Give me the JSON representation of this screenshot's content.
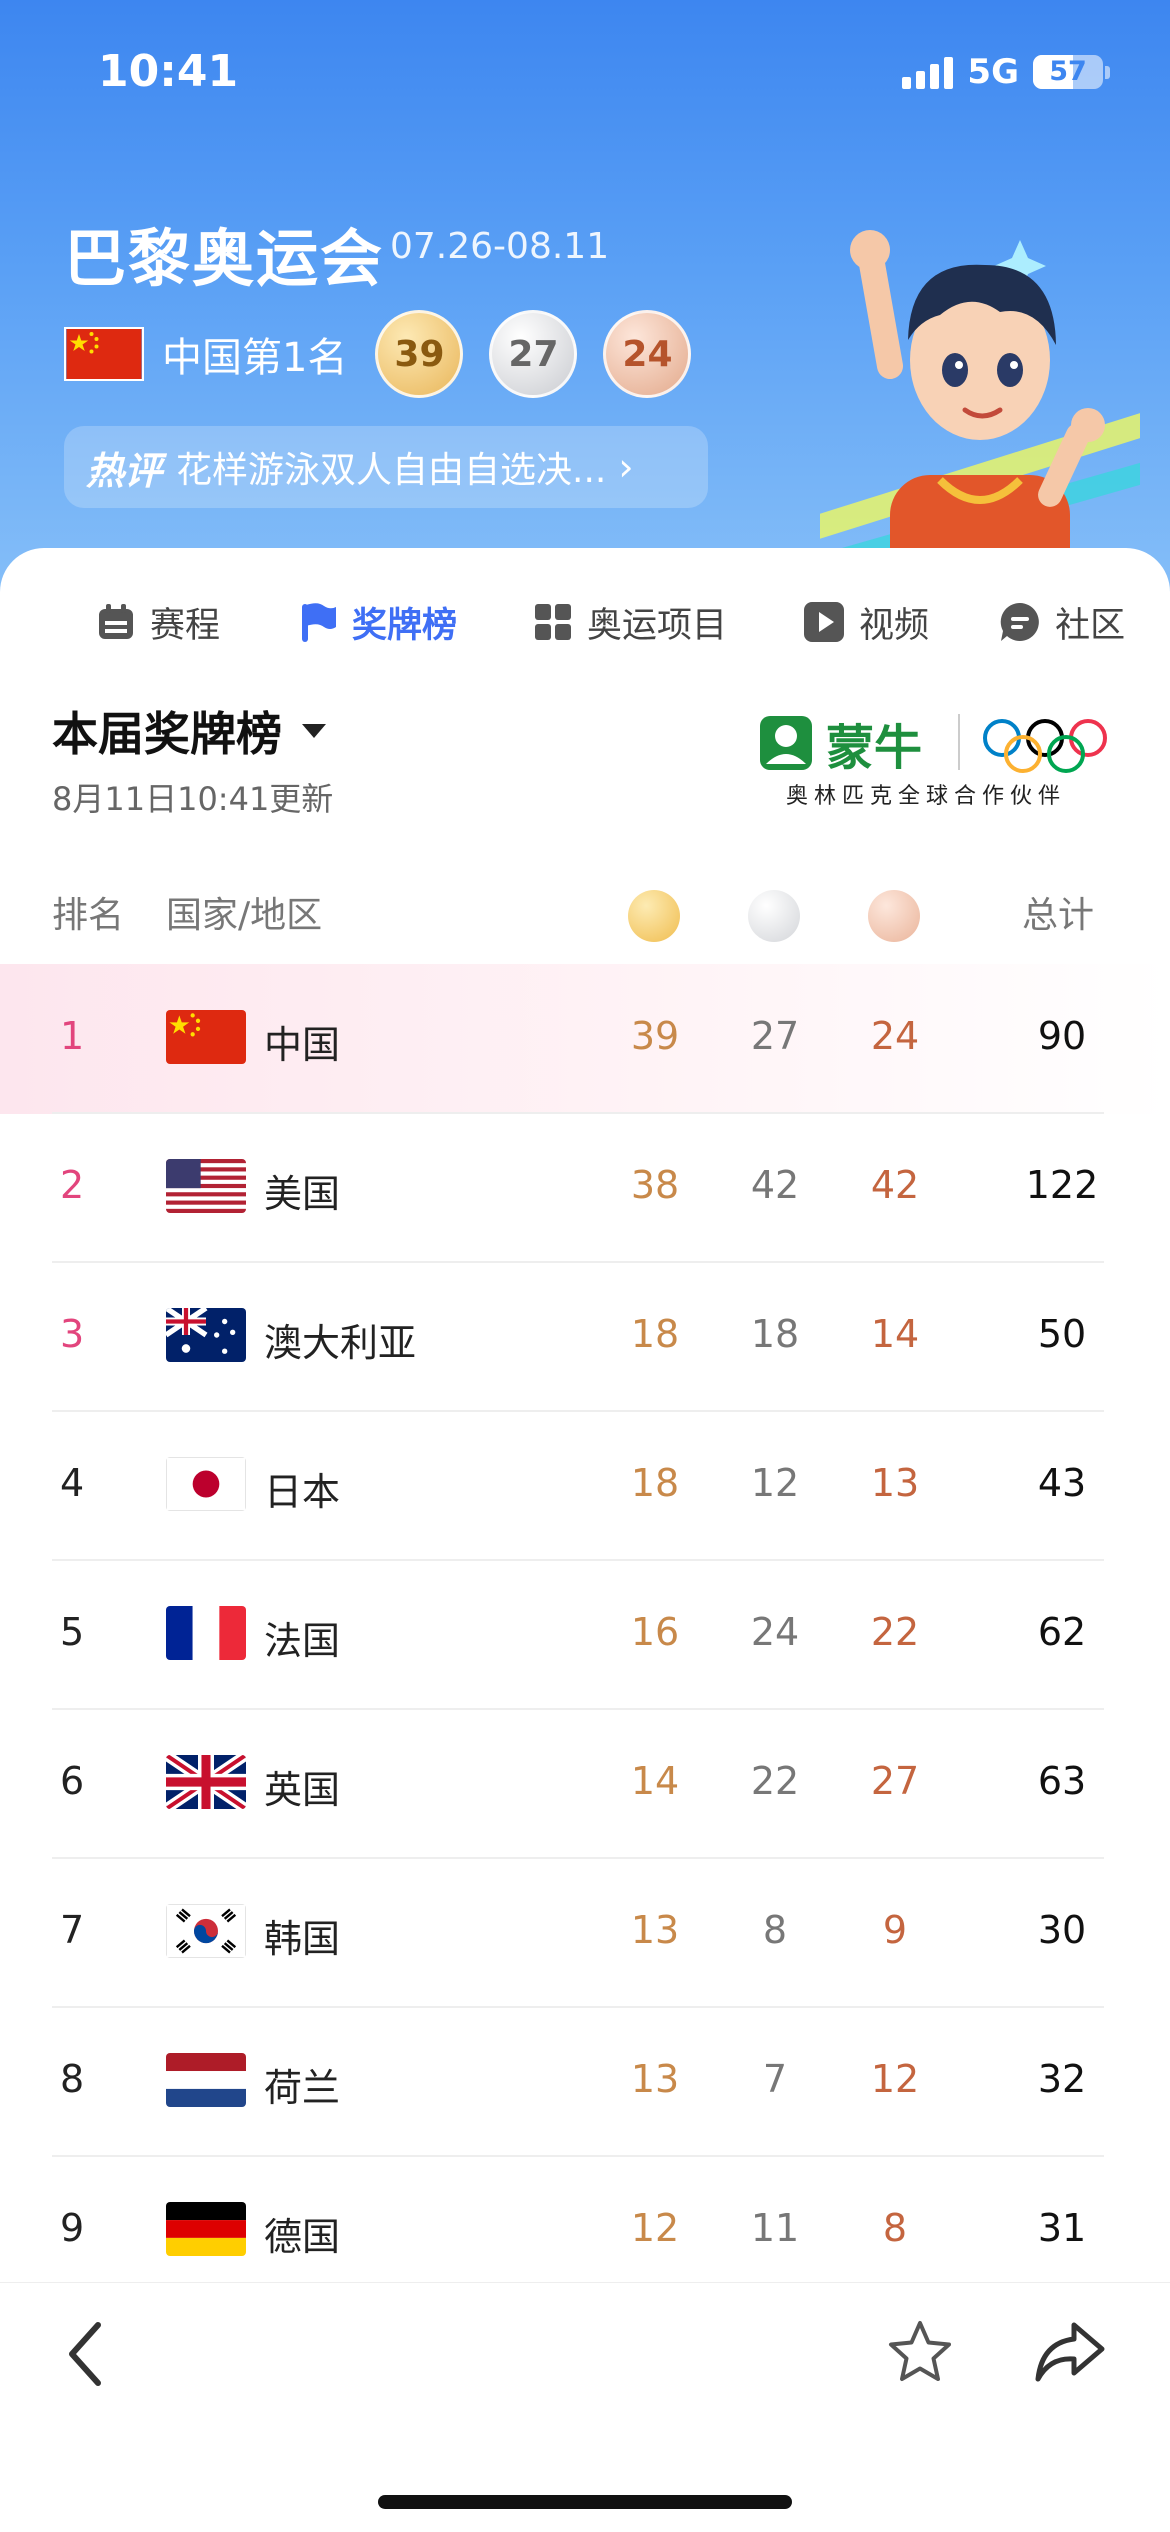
{
  "status_bar": {
    "time": "10:41",
    "network": "5G",
    "battery": "57"
  },
  "header": {
    "title": "巴黎奥运会",
    "dates": "07.26-08.11",
    "rank_text": "中国第1名",
    "medals": {
      "gold": "39",
      "silver": "27",
      "bronze": "24"
    },
    "hot": {
      "tag": "热评",
      "text": "花样游泳双人自由自选决..."
    }
  },
  "tabs": [
    {
      "label": "赛程",
      "icon": "calendar-icon",
      "active": false
    },
    {
      "label": "奖牌榜",
      "icon": "flag-icon",
      "active": true
    },
    {
      "label": "奥运项目",
      "icon": "grid-icon",
      "active": false
    },
    {
      "label": "视频",
      "icon": "play-icon",
      "active": false
    },
    {
      "label": "社区",
      "icon": "chat-icon",
      "active": false
    }
  ],
  "board": {
    "title": "本届奖牌榜",
    "updated": "8月11日10:41更新",
    "sponsor": {
      "name": "蒙牛",
      "subtitle": "奥林匹克全球合作伙伴"
    }
  },
  "table": {
    "headers": {
      "rank": "排名",
      "country": "国家/地区",
      "total": "总计"
    },
    "rows": [
      {
        "rank": "1",
        "country": "中国",
        "flag": "china-flag",
        "gold": "39",
        "silver": "27",
        "bronze": "24",
        "total": "90"
      },
      {
        "rank": "2",
        "country": "美国",
        "flag": "usa-flag",
        "gold": "38",
        "silver": "42",
        "bronze": "42",
        "total": "122"
      },
      {
        "rank": "3",
        "country": "澳大利亚",
        "flag": "australia-flag",
        "gold": "18",
        "silver": "18",
        "bronze": "14",
        "total": "50"
      },
      {
        "rank": "4",
        "country": "日本",
        "flag": "japan-flag",
        "gold": "18",
        "silver": "12",
        "bronze": "13",
        "total": "43"
      },
      {
        "rank": "5",
        "country": "法国",
        "flag": "france-flag",
        "gold": "16",
        "silver": "24",
        "bronze": "22",
        "total": "62"
      },
      {
        "rank": "6",
        "country": "英国",
        "flag": "uk-flag",
        "gold": "14",
        "silver": "22",
        "bronze": "27",
        "total": "63"
      },
      {
        "rank": "7",
        "country": "韩国",
        "flag": "korea-flag",
        "gold": "13",
        "silver": "8",
        "bronze": "9",
        "total": "30"
      },
      {
        "rank": "8",
        "country": "荷兰",
        "flag": "netherlands-flag",
        "gold": "13",
        "silver": "7",
        "bronze": "12",
        "total": "32"
      },
      {
        "rank": "9",
        "country": "德国",
        "flag": "germany-flag",
        "gold": "12",
        "silver": "11",
        "bronze": "8",
        "total": "31"
      }
    ]
  },
  "colors": {
    "accent": "#3f6ff5",
    "rank_top3": "#e2457d",
    "gold_text": "#c8894a",
    "bronze_text": "#c4653f"
  },
  "bottom_bar": {
    "icons": [
      "back-icon",
      "star-icon",
      "share-icon"
    ]
  }
}
